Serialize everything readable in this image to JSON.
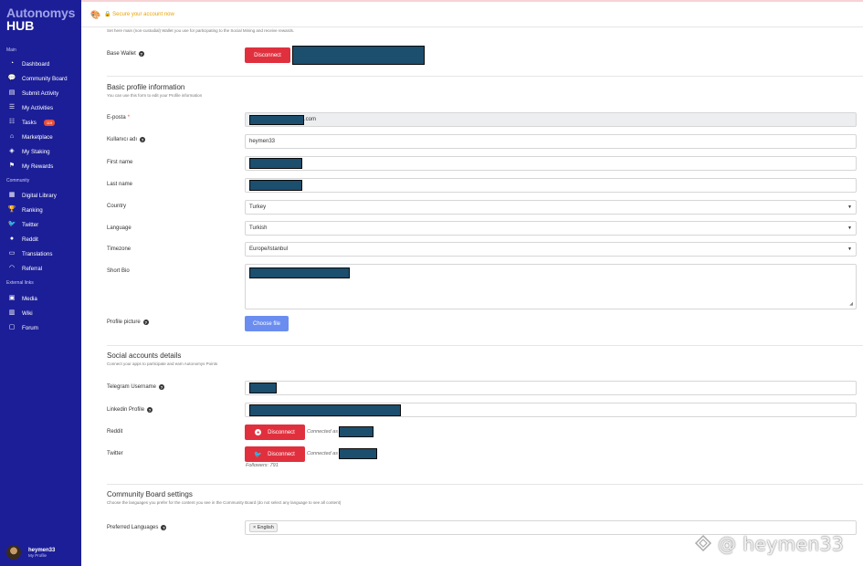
{
  "sidebar": {
    "logo_line1": "Autonomys",
    "logo_line2": "HUB",
    "main_title": "Main",
    "main_items": [
      {
        "label": "Dashboard",
        "icon": "dashboard-icon"
      },
      {
        "label": "Community Board",
        "icon": "chat-icon"
      },
      {
        "label": "Submit Activity",
        "icon": "document-icon"
      },
      {
        "label": "My Activities",
        "icon": "list-icon"
      },
      {
        "label": "Tasks",
        "icon": "tasks-icon",
        "badge": "119"
      },
      {
        "label": "Marketplace",
        "icon": "store-icon"
      },
      {
        "label": "My Staking",
        "icon": "staking-icon"
      },
      {
        "label": "My Rewards",
        "icon": "rewards-icon"
      }
    ],
    "community_title": "Community",
    "community_items": [
      {
        "label": "Digital Library",
        "icon": "library-icon"
      },
      {
        "label": "Ranking",
        "icon": "trophy-icon"
      },
      {
        "label": "Twitter",
        "icon": "twitter-icon"
      },
      {
        "label": "Reddit",
        "icon": "reddit-icon"
      },
      {
        "label": "Translations",
        "icon": "translate-icon"
      },
      {
        "label": "Referral",
        "icon": "rss-icon"
      }
    ],
    "external_title": "External links",
    "external_items": [
      {
        "label": "Media",
        "icon": "media-icon"
      },
      {
        "label": "Wiki",
        "icon": "book-icon"
      },
      {
        "label": "Forum",
        "icon": "forum-icon"
      }
    ],
    "user": {
      "name": "heymen33",
      "sub": "My Profile"
    }
  },
  "topbar": {
    "secure_text": "Secure your account now"
  },
  "wallet": {
    "hint": "Set here main (non-custodial) Wallet you use for participating to the Social Mining and receive rewards.",
    "label": "Base Wallet",
    "button": "Disconnect"
  },
  "basic": {
    "title": "Basic profile information",
    "hint": "You can use this form to edit your Profile information",
    "email_label": "E-posta",
    "email_suffix": ".com",
    "username_label": "Kullanıcı adı",
    "username_value": "heymen33",
    "first_name_label": "First name",
    "last_name_label": "Last name",
    "country_label": "Country",
    "country_value": "Turkey",
    "language_label": "Language",
    "language_value": "Turkish",
    "timezone_label": "Timezone",
    "timezone_value": "Europe/Istanbul",
    "bio_label": "Short Bio",
    "picture_label": "Profile picture",
    "choose_file": "Choose file"
  },
  "social": {
    "title": "Social accounts details",
    "hint": "Connect your apps to participate and earn Autonomys Points",
    "telegram_label": "Telegram Username",
    "linkedin_label": "Linkedin Profile",
    "reddit_label": "Reddit",
    "twitter_label": "Twitter",
    "disconnect": "Disconnect",
    "connected_as": "Connected as",
    "followers": "Followers: 791"
  },
  "community": {
    "title": "Community Board settings",
    "hint": "Choose the languages you prefer for the content you see in the Community Board (do not select any language to see all content)",
    "preferred_label": "Preferred Languages",
    "tag": "English",
    "tag_remove": "×"
  },
  "watermark": "@ heymen33",
  "colors": {
    "sidebar": "#1c1e97",
    "danger": "#e0303e",
    "primary": "#6b8df0",
    "warning": "#e8a400"
  }
}
